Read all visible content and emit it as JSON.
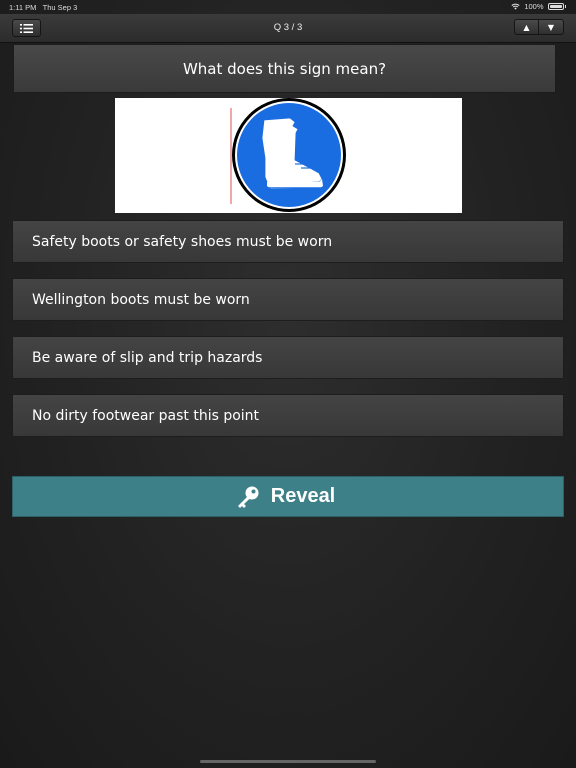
{
  "status": {
    "time": "1:11 PM",
    "date": "Thu Sep 3",
    "battery": "100%"
  },
  "navbar": {
    "title": "Q 3 / 3",
    "up_label": "▲",
    "down_label": "▼"
  },
  "question": {
    "text": "What does this sign mean?"
  },
  "answers": [
    {
      "label": "Safety boots or safety shoes must be worn"
    },
    {
      "label": "Wellington boots must be worn"
    },
    {
      "label": "Be aware of slip and trip hazards"
    },
    {
      "label": "No dirty footwear past this point"
    }
  ],
  "reveal": {
    "label": "Reveal"
  },
  "colors": {
    "accent": "#3d8088",
    "sign_blue": "#1a6de0"
  }
}
